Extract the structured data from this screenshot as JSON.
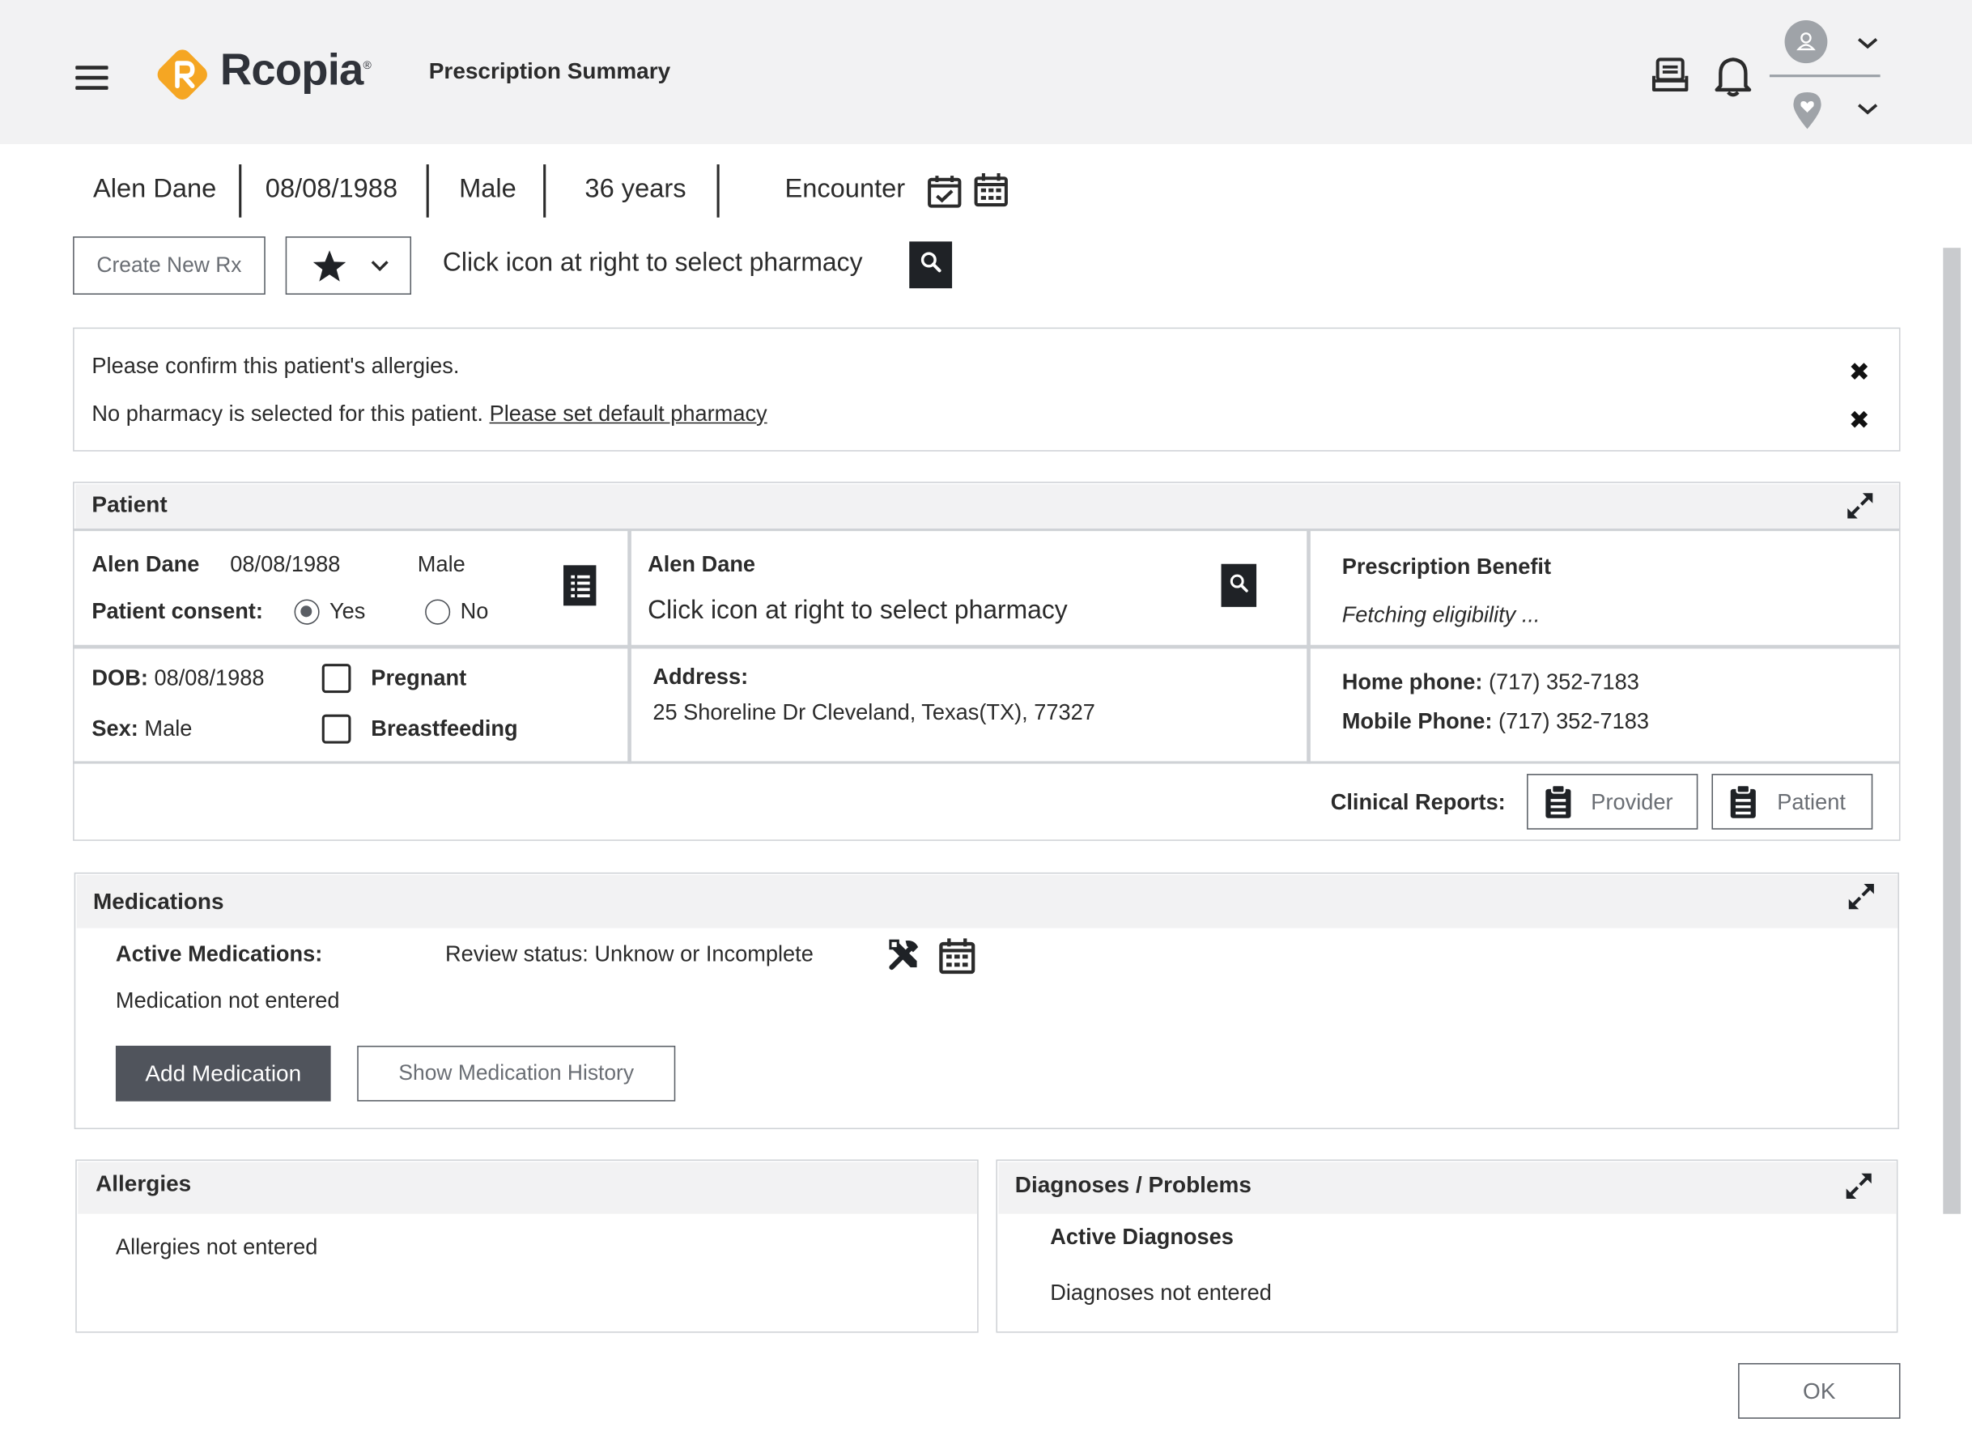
{
  "header": {
    "app_name": "Rcopia",
    "page_title": "Prescription Summary"
  },
  "patient_strip": {
    "name": "Alen Dane",
    "dob": "08/08/1988",
    "sex": "Male",
    "age": "36 years",
    "encounter_label": "Encounter"
  },
  "toolbar": {
    "create_rx_label": "Create New Rx",
    "pharmacy_prompt": "Click icon at right to select pharmacy"
  },
  "alerts": {
    "allergy_msg": "Please confirm this patient's allergies.",
    "pharmacy_msg": "No pharmacy is selected for this patient.",
    "pharmacy_link": "Please set default pharmacy"
  },
  "patient_panel": {
    "title": "Patient",
    "name": "Alen Dane",
    "dob": "08/08/1988",
    "sex": "Male",
    "consent_label": "Patient consent:",
    "consent_yes": "Yes",
    "consent_no": "No",
    "consent_value": "Yes",
    "pharmacy_name": "Alen Dane",
    "pharmacy_prompt": "Click icon at right to select pharmacy",
    "benefit_title": "Prescription Benefit",
    "benefit_status": "Fetching eligibility ...",
    "dob_label": "DOB:",
    "dob_value": "08/08/1988",
    "sex_label": "Sex:",
    "sex_value": "Male",
    "pregnant_label": "Pregnant",
    "breastfeeding_label": "Breastfeeding",
    "address_label": "Address:",
    "address_value": "25 Shoreline Dr Cleveland, Texas(TX), 77327",
    "home_phone_label": "Home phone:",
    "home_phone_value": "(717) 352-7183",
    "mobile_phone_label": "Mobile Phone:",
    "mobile_phone_value": "(717) 352-7183",
    "clinical_reports_label": "Clinical Reports:",
    "provider_btn": "Provider",
    "patient_btn": "Patient"
  },
  "medications": {
    "title": "Medications",
    "active_label": "Active Medications:",
    "review_status": "Review status: Unknow or Incomplete",
    "empty_msg": "Medication not entered",
    "add_btn": "Add Medication",
    "history_btn": "Show Medication History"
  },
  "allergies": {
    "title": "Allergies",
    "empty_msg": "Allergies not entered"
  },
  "diagnoses": {
    "title": "Diagnoses / Problems",
    "active_label": "Active Diagnoses",
    "empty_msg": "Diagnoses not entered"
  },
  "footer": {
    "ok_btn": "OK"
  },
  "icons": [
    "menu-icon",
    "rcopia-logo-icon",
    "message-icon",
    "bell-icon",
    "user-icon",
    "chevron-down-icon",
    "location-pin-icon",
    "calendar-check-icon",
    "calendar-icon",
    "star-icon",
    "search-icon",
    "close-icon",
    "expand-icon",
    "list-icon",
    "clipboard-icon",
    "tools-icon"
  ],
  "colors": {
    "brand_orange": "#f5a623",
    "header_bg": "#f2f2f3",
    "primary_button": "#50545c",
    "dark_square": "#1f2226"
  }
}
